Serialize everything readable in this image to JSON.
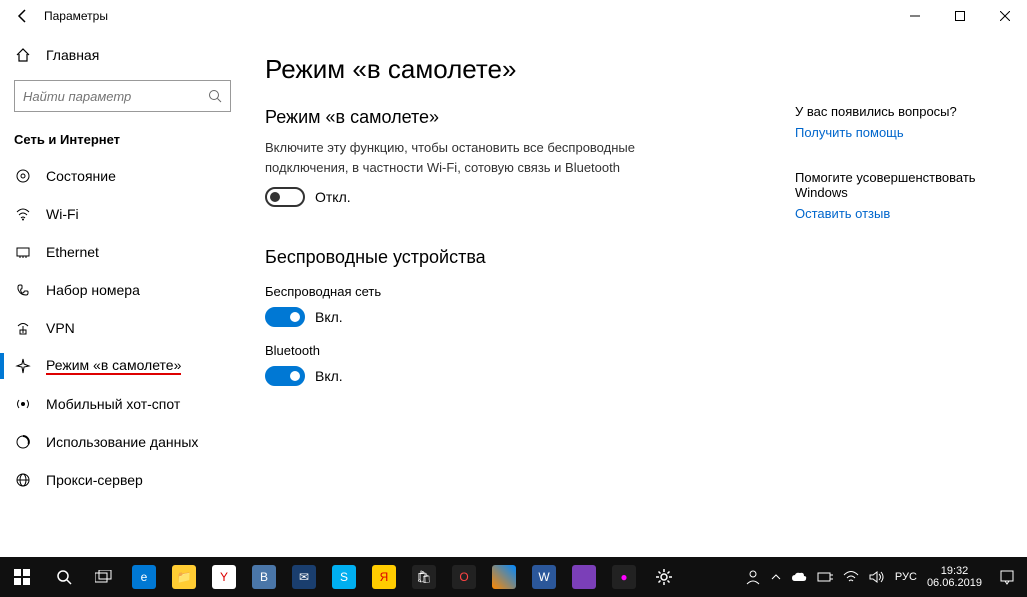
{
  "window": {
    "title": "Параметры"
  },
  "sidebar": {
    "home": "Главная",
    "search_placeholder": "Найти параметр",
    "category": "Сеть и Интернет",
    "items": [
      {
        "label": "Состояние"
      },
      {
        "label": "Wi-Fi"
      },
      {
        "label": "Ethernet"
      },
      {
        "label": "Набор номера"
      },
      {
        "label": "VPN"
      },
      {
        "label": "Режим «в самолете»"
      },
      {
        "label": "Мобильный хот-спот"
      },
      {
        "label": "Использование данных"
      },
      {
        "label": "Прокси-сервер"
      }
    ]
  },
  "page": {
    "title": "Режим «в самолете»",
    "section1_title": "Режим «в самолете»",
    "desc": "Включите эту функцию, чтобы остановить все беспроводные подключения, в частности Wi-Fi, сотовую связь и Bluetooth",
    "airplane_state": "Откл.",
    "section2_title": "Беспроводные устройства",
    "wifi_label": "Беспроводная сеть",
    "wifi_state": "Вкл.",
    "bt_label": "Bluetooth",
    "bt_state": "Вкл."
  },
  "help": {
    "q1": "У вас появились вопросы?",
    "link1": "Получить помощь",
    "q2": "Помогите усовершенствовать Windows",
    "link2": "Оставить отзыв"
  },
  "taskbar": {
    "lang": "РУС",
    "time": "19:32",
    "date": "06.06.2019"
  }
}
